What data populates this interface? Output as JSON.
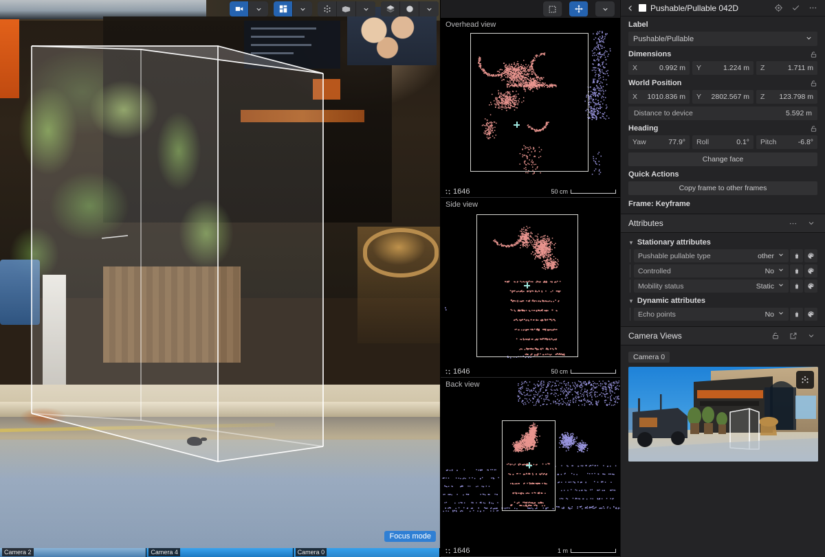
{
  "viewport": {
    "toolbar": [
      {
        "name": "camera-view-button",
        "icon": "camera-icon",
        "active": true
      },
      {
        "name": "camera-dropdown-button",
        "icon": "chevron-down-icon",
        "active": false
      },
      {
        "name": "grid-layout-button",
        "icon": "grid-icon",
        "active": true
      },
      {
        "name": "grid-layout-dropdown-button",
        "icon": "chevron-down-icon",
        "active": false
      },
      {
        "name": "point-cloud-button",
        "icon": "points-icon",
        "active": false
      },
      {
        "name": "cuboid-button",
        "icon": "cuboid-icon",
        "active": false
      },
      {
        "name": "cuboid-dropdown-button",
        "icon": "chevron-down-icon",
        "active": false
      },
      {
        "name": "layers-button",
        "icon": "layers-icon",
        "active": false
      },
      {
        "name": "sphere-button",
        "icon": "sphere-icon",
        "active": false
      },
      {
        "name": "sphere-dropdown-button",
        "icon": "chevron-down-icon",
        "active": false
      },
      {
        "name": "fullscreen-button",
        "icon": "fullscreen-icon",
        "active": false
      }
    ],
    "focus_badge": "Focus mode",
    "camera_strip": [
      "Camera 2",
      "Camera 4",
      "Camera 0"
    ]
  },
  "point_cloud": {
    "toolbar": [
      {
        "name": "select-region-button",
        "icon": "dashed-square-icon",
        "active": false
      },
      {
        "name": "move-tool-button",
        "icon": "move-icon",
        "active": true
      },
      {
        "name": "view-options-dropdown",
        "icon": "chevron-down-icon",
        "active": false
      }
    ],
    "views": [
      {
        "title": "Overhead view",
        "count": "1646",
        "scale": "50 cm"
      },
      {
        "title": "Side view",
        "count": "1646",
        "scale": "50 cm"
      },
      {
        "title": "Back view",
        "count": "1646",
        "scale": "1 m"
      }
    ],
    "colors": {
      "in_box_points": "#e9958f",
      "out_box_points": "#9a96e0",
      "box_outline": "#d8d8d4",
      "center_marker": "#9fe8e0"
    }
  },
  "panel": {
    "header": {
      "title": "Pushable/Pullable 042D",
      "back_icon": "chevron-left-icon",
      "swatch_color": "#ffffff",
      "actions": [
        {
          "name": "locate-object-button",
          "icon": "target-icon"
        },
        {
          "name": "confirm-button",
          "icon": "check-icon"
        },
        {
          "name": "more-options-button",
          "icon": "ellipsis-icon"
        }
      ]
    },
    "label": {
      "section_label": "Label",
      "value": "Pushable/Pullable",
      "chevron": "chevron-down-icon"
    },
    "dimensions": {
      "section_label": "Dimensions",
      "locked": true,
      "fields": [
        {
          "key": "X",
          "value": "0.992 m"
        },
        {
          "key": "Y",
          "value": "1.224 m"
        },
        {
          "key": "Z",
          "value": "1.711 m"
        }
      ]
    },
    "world_position": {
      "section_label": "World Position",
      "locked": true,
      "fields": [
        {
          "key": "X",
          "value": "1010.836 m"
        },
        {
          "key": "Y",
          "value": "2802.567 m"
        },
        {
          "key": "Z",
          "value": "123.798 m"
        }
      ],
      "distance_label": "Distance to device",
      "distance_value": "5.592 m"
    },
    "heading": {
      "section_label": "Heading",
      "locked": true,
      "fields": [
        {
          "key": "Yaw",
          "value": "77.9°"
        },
        {
          "key": "Roll",
          "value": "0.1°"
        },
        {
          "key": "Pitch",
          "value": "-6.8°"
        }
      ],
      "change_face_label": "Change face"
    },
    "quick_actions": {
      "section_label": "Quick Actions",
      "copy_frame_label": "Copy frame to other frames"
    },
    "frame_text": "Frame: Keyframe",
    "attributes": {
      "header_title": "Attributes",
      "header_icons": [
        "ellipsis-icon",
        "chevron-down-icon"
      ],
      "groups": [
        {
          "title": "Stationary attributes",
          "rows": [
            {
              "name": "Pushable pullable type",
              "value": "other"
            },
            {
              "name": "Controlled",
              "value": "No"
            },
            {
              "name": "Mobility status",
              "value": "Static"
            }
          ]
        },
        {
          "title": "Dynamic attributes",
          "rows": [
            {
              "name": "Echo points",
              "value": "No"
            }
          ]
        }
      ],
      "row_icons": [
        "trash-icon",
        "palette-icon"
      ]
    },
    "camera_views": {
      "header_title": "Camera Views",
      "header_icons": [
        "lock-icon",
        "external-link-icon",
        "chevron-down-icon"
      ],
      "chip_label": "Camera 0",
      "thumb_button_icon": "points-icon"
    }
  }
}
